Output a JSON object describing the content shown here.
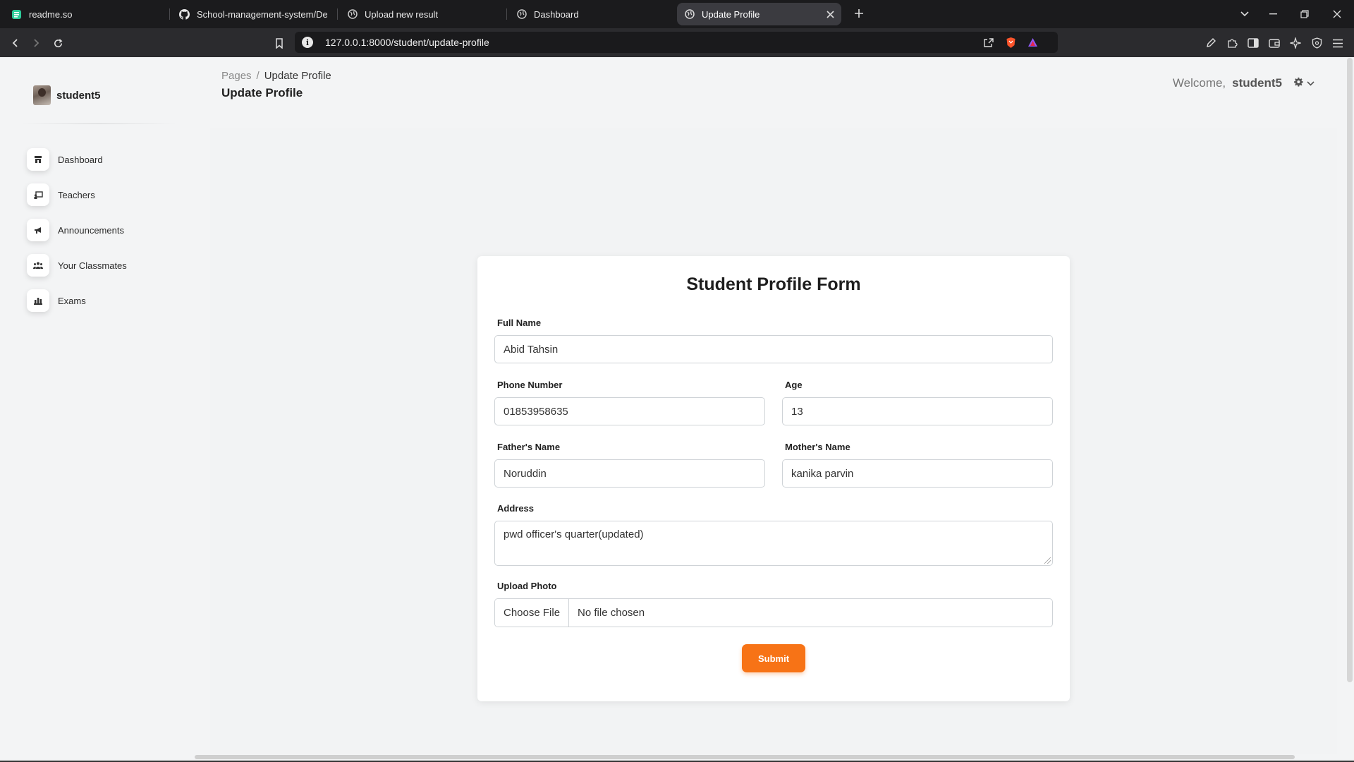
{
  "browser": {
    "tabs": [
      {
        "title": "readme.so",
        "icon": "readme-icon",
        "active": false
      },
      {
        "title": "School-management-system/Demo",
        "icon": "github-icon",
        "active": false
      },
      {
        "title": "Upload new result",
        "icon": "globe-icon",
        "active": false
      },
      {
        "title": "Dashboard",
        "icon": "globe-icon",
        "active": false
      },
      {
        "title": "Update Profile",
        "icon": "globe-icon",
        "active": true
      }
    ],
    "url": "127.0.0.1:8000/student/update-profile"
  },
  "sidebar": {
    "brand": "student5",
    "items": [
      {
        "label": "Dashboard",
        "icon": "shop-icon"
      },
      {
        "label": "Teachers",
        "icon": "teacher-icon"
      },
      {
        "label": "Announcements",
        "icon": "megaphone-icon"
      },
      {
        "label": "Your Classmates",
        "icon": "users-icon"
      },
      {
        "label": "Exams",
        "icon": "chart-icon"
      }
    ]
  },
  "header": {
    "breadcrumb_root": "Pages",
    "breadcrumb_sep": "/",
    "breadcrumb_current": "Update Profile",
    "title": "Update Profile",
    "welcome": "Welcome,",
    "username": "student5"
  },
  "form": {
    "title": "Student Profile Form",
    "full_name": {
      "label": "Full Name",
      "value": "Abid Tahsin"
    },
    "phone": {
      "label": "Phone Number",
      "value": "01853958635"
    },
    "age": {
      "label": "Age",
      "value": "13"
    },
    "father": {
      "label": "Father's Name",
      "value": "Noruddin"
    },
    "mother": {
      "label": "Mother's Name",
      "value": "kanika parvin"
    },
    "address": {
      "label": "Address",
      "value": "pwd officer's quarter(updated)"
    },
    "photo": {
      "label": "Upload Photo",
      "button": "Choose File",
      "status": "No file chosen"
    },
    "submit": "Submit"
  },
  "colors": {
    "accent": "#f77316",
    "tab_active": "#3b3b40",
    "tabbar": "#1b1b1d"
  }
}
